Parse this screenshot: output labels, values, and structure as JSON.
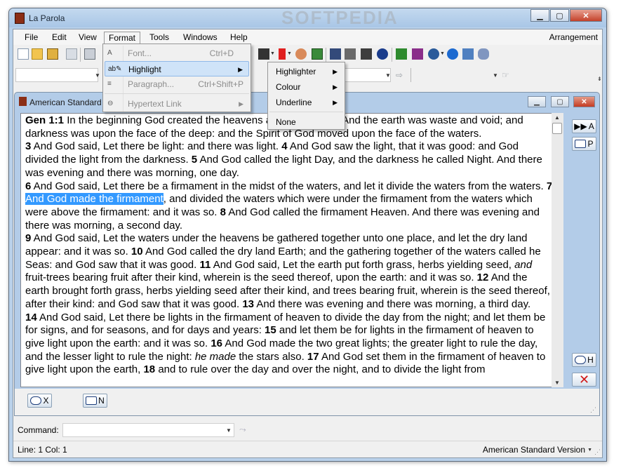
{
  "window": {
    "title": "La Parola",
    "watermark": "SOFTPEDIA"
  },
  "menubar": {
    "items": [
      "File",
      "Edit",
      "View",
      "Format",
      "Tools",
      "Windows",
      "Help"
    ],
    "right": "Arrangement"
  },
  "format_menu": {
    "items": [
      {
        "label": "Font...",
        "shortcut": "Ctrl+D",
        "disabled": true
      },
      {
        "label": "Highlight",
        "shortcut": "",
        "disabled": false
      },
      {
        "label": "Paragraph...",
        "shortcut": "Ctrl+Shift+P",
        "disabled": true
      },
      {
        "label": "Hypertext Link",
        "shortcut": "",
        "disabled": true
      }
    ]
  },
  "highlight_submenu": {
    "items": [
      "Highlighter",
      "Colour",
      "Underline",
      "None"
    ]
  },
  "child_window": {
    "title": "American Standard"
  },
  "side_buttons": {
    "play": "A",
    "page": "P",
    "hist": "H"
  },
  "bottom_buttons": {
    "x": "X",
    "n": "N"
  },
  "text": {
    "p1_ref": "Gen 1:1",
    "p1_a": " In the beginning God created the heavens and the earth.",
    "p1_n2": " 2",
    "p1_b": " And the earth was waste and void; and darkness was upon the face of the deep: and the Spirit of God moved upon the face of the waters.",
    "p2_n3": "3",
    "p2_a": " And God said, Let there be light: and there was light.",
    "p2_n4": " 4",
    "p2_b": " And God saw the light, that it was good: and God divided the light from the darkness.",
    "p2_n5": " 5",
    "p2_c": " And God called the light Day, and the darkness he called Night. And there was evening and there was morning, one day.",
    "p3_n6": "6",
    "p3_a": " And God said, Let there be a firmament in the midst of the waters, and let it divide the waters from the waters.",
    "p3_n7": " 7",
    "p3_hl": "And God made the firmament",
    "p3_b": ", and divided the waters which were under the firmament from the waters which were above the firmament: and it was so.",
    "p3_n8": " 8",
    "p3_c": " And God called the firmament Heaven. And there was evening and there was morning, a second day.",
    "p4_n9": "9",
    "p4_a": " And God said, Let the waters under the heavens be gathered together unto one place, and let the dry land appear: and it was so.",
    "p4_n10": " 10",
    "p4_b": " And God called the dry land Earth; and the gathering together of the waters called he Seas: and God saw that it was good.",
    "p4_n11": " 11",
    "p4_c": " And God said, Let the earth put forth grass, herbs yielding seed,",
    "p4_i1": "and",
    "p4_d": " fruit-trees bearing fruit after their kind, wherein is the seed thereof, upon the earth: and it was so.",
    "p4_n12": " 12",
    "p4_e": " And the earth brought forth grass, herbs yielding seed after their kind, and trees bearing fruit, wherein is the seed thereof, after their kind: and God saw that it was good.",
    "p4_n13": " 13",
    "p4_f": " And there was evening and there was morning, a third day.",
    "p5_n14": "14",
    "p5_a": " And God said, Let there be lights in the firmament of heaven to divide the day from the night; and let them be for signs, and for seasons, and for days and years:",
    "p5_n15": " 15",
    "p5_b": " and let them be for lights in the firmament of heaven to give light upon the earth: and it was so.",
    "p5_n16": " 16",
    "p5_c": " And God made the two great lights; the greater light to rule the day, and the lesser light to rule the night:",
    "p5_i1": "he made",
    "p5_d": " the stars also.",
    "p5_n17": " 17",
    "p5_e": " And God set them in the firmament of heaven to give light upon the earth,",
    "p5_n18": " 18",
    "p5_f": " and to rule over the day and over the night, and to divide the light from"
  },
  "command": {
    "label": "Command:",
    "value": ""
  },
  "status": {
    "position": "Line: 1 Col: 1",
    "version": "American Standard Version"
  }
}
